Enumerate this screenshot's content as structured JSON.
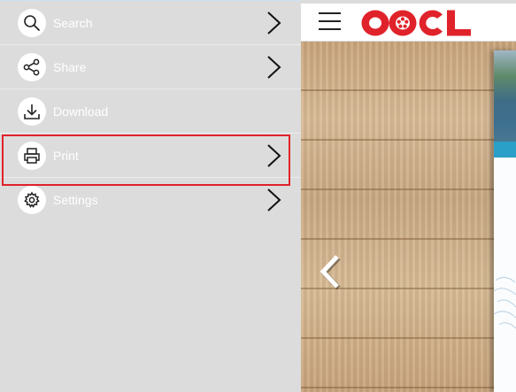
{
  "menu": {
    "items": [
      {
        "label": "Search",
        "icon": "search-icon",
        "has_submenu": true
      },
      {
        "label": "Share",
        "icon": "share-icon",
        "has_submenu": true
      },
      {
        "label": "Download",
        "icon": "download-icon",
        "has_submenu": false
      },
      {
        "label": "Print",
        "icon": "printer-icon",
        "has_submenu": true,
        "highlighted": true
      },
      {
        "label": "Settings",
        "icon": "gear-icon",
        "has_submenu": true
      }
    ]
  },
  "header": {
    "logo_text": "OOCL",
    "menu_icon": "hamburger-icon"
  },
  "viewer": {
    "prev_icon": "chevron-left-icon"
  },
  "colors": {
    "menu_bg": "#dcdcdc",
    "menu_text": "#ffffff",
    "highlight": "#e0222a",
    "brand_red": "#e0222a",
    "band": "#2a9fc7"
  }
}
